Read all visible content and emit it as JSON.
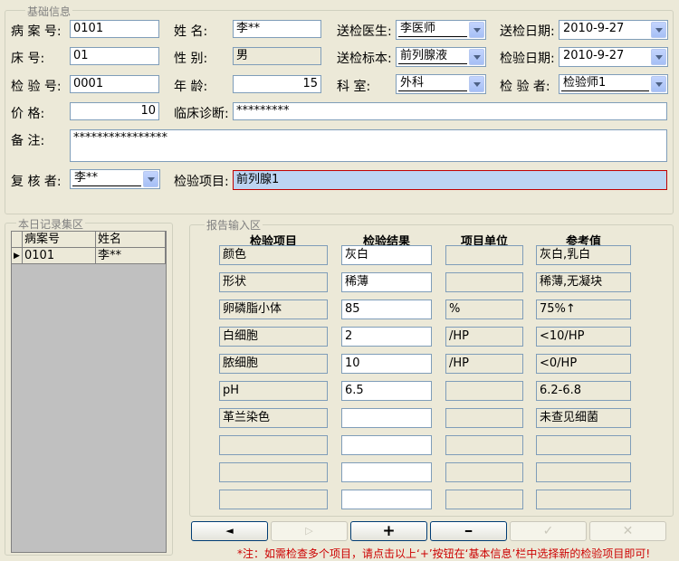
{
  "basic": {
    "legend": "基础信息",
    "case_no_label": "病 案 号:",
    "case_no": "0101",
    "bed_label": "床    号:",
    "bed": "01",
    "test_no_label": "检 验 号:",
    "test_no": "0001",
    "price_label": "价    格:",
    "price": "10",
    "remark_label": "备    注:",
    "remark": "****************",
    "reviewer_label": "复 核 者:",
    "reviewer": "李**",
    "name_label": "姓    名:",
    "name": "李**",
    "sex_label": "性    别:",
    "sex": "男",
    "age_label": "年    龄:",
    "age": "15",
    "diagnosis_label": "临床诊断:",
    "diagnosis": "*********",
    "item_label": "检验项目:",
    "item": "前列腺1",
    "doctor_label": "送检医生:",
    "doctor": "李医师",
    "specimen_label": "送检标本:",
    "specimen": "前列腺液",
    "dept_label": "科    室:",
    "dept": "外科",
    "send_date_label": "送检日期:",
    "send_date": "2010-9-27",
    "test_date_label": "检验日期:",
    "test_date": "2010-9-27",
    "tester_label": "检 验 者:",
    "tester": "检验师1"
  },
  "records": {
    "legend": "本日记录集区",
    "columns": [
      "病案号",
      "姓名"
    ],
    "rows": [
      [
        "0101",
        "李**"
      ]
    ]
  },
  "report": {
    "legend": "报告输入区",
    "headers": [
      "检验项目",
      "检验结果",
      "项目单位",
      "参考值"
    ],
    "rows": [
      [
        "颜色",
        "灰白",
        "",
        "灰白,乳白"
      ],
      [
        "形状",
        "稀薄",
        "",
        "稀薄,无凝块"
      ],
      [
        "卵磷脂小体",
        "85",
        "%",
        "75%↑"
      ],
      [
        "白细胞",
        "2",
        "/HP",
        "<10/HP"
      ],
      [
        "脓细胞",
        "10",
        "/HP",
        "<0/HP"
      ],
      [
        "pH",
        "6.5",
        "",
        "6.2-6.8"
      ],
      [
        "革兰染色",
        "",
        "",
        "未查见细菌"
      ],
      [
        "",
        "",
        "",
        ""
      ],
      [
        "",
        "",
        "",
        ""
      ],
      [
        "",
        "",
        "",
        ""
      ]
    ]
  },
  "nav": {
    "prev": "◄",
    "next": "▷",
    "add": "+",
    "delete": "━",
    "confirm": "✓",
    "cancel": "✕"
  },
  "footer_note": "*注：如需检查多个项目，请点击以上‘+’按钮在‘基本信息’栏中选择新的检验项目即可!",
  "colors": {
    "note": "#cc0000",
    "item_highlight": "#bcd4f2",
    "item_border": "#c00000"
  }
}
